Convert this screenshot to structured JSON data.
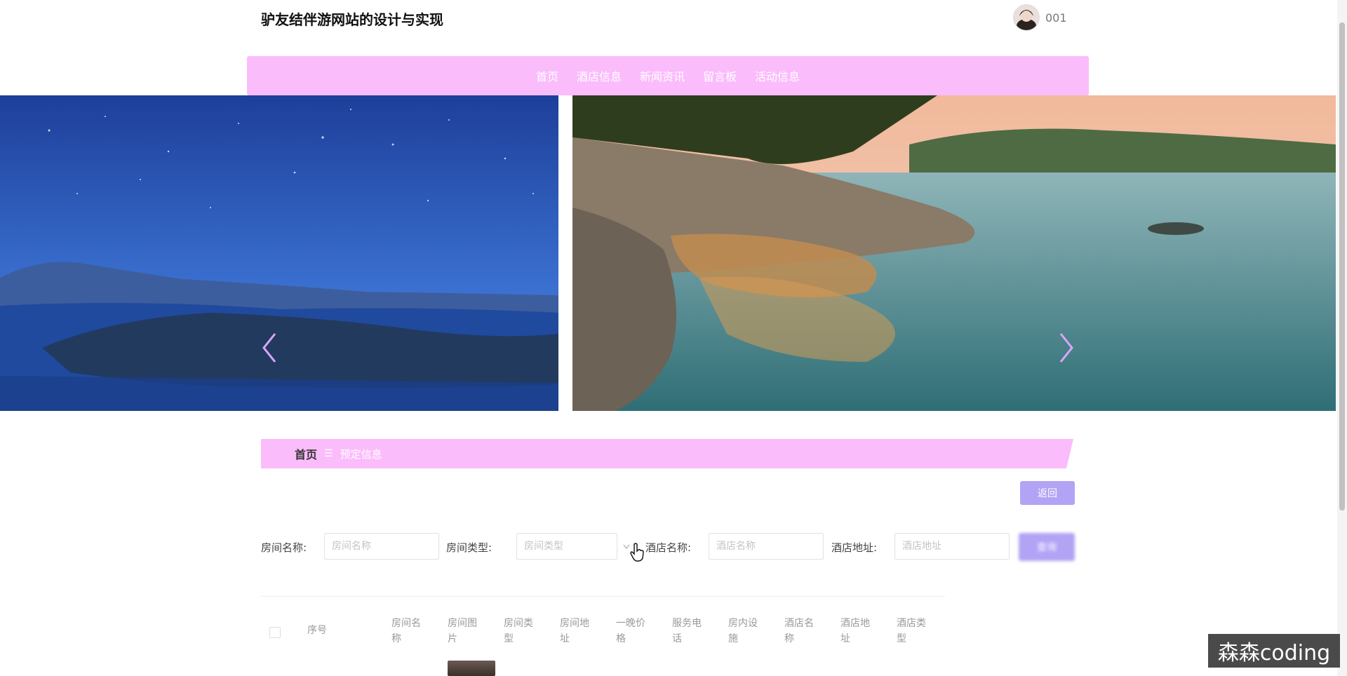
{
  "header": {
    "site_title": "驴友结伴游网站的设计与实现",
    "username": "001"
  },
  "nav": {
    "items": [
      "首页",
      "酒店信息",
      "新闻资讯",
      "留言板",
      "活动信息"
    ]
  },
  "breadcrumb": {
    "home": "首页",
    "separator": "☰",
    "current": "预定信息"
  },
  "actions": {
    "back_label": "返回",
    "search_label": "查询"
  },
  "search": {
    "room_name": {
      "label": "房间名称:",
      "placeholder": "房间名称"
    },
    "room_type": {
      "label": "房间类型:",
      "placeholder": "房间类型"
    },
    "hotel_name": {
      "label": "酒店名称:",
      "placeholder": "酒店名称"
    },
    "hotel_address": {
      "label": "酒店地址:",
      "placeholder": "酒店地址"
    }
  },
  "table": {
    "columns": [
      "序号",
      "房间名称",
      "房间图片",
      "房间类型",
      "房间地址",
      "一晚价格",
      "服务电话",
      "房内设施",
      "酒店名称",
      "酒店地址",
      "酒店类型"
    ]
  },
  "watermark": "森森coding",
  "colors": {
    "nav_bg": "#fbbcfb",
    "button": "#b3a3f5",
    "arrow": "#d8a6ff"
  }
}
